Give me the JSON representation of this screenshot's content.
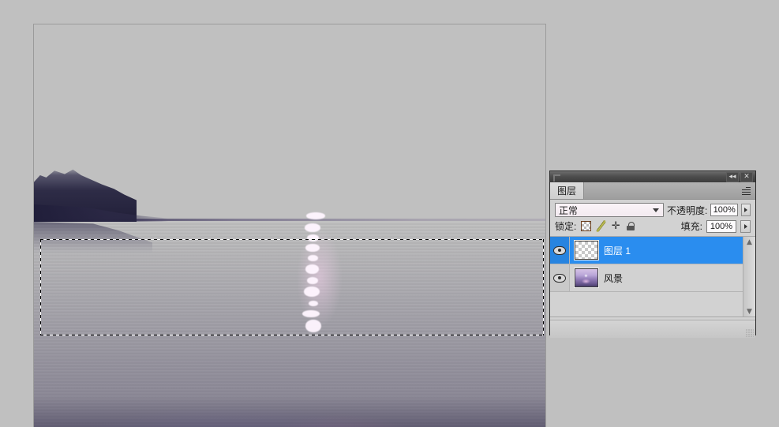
{
  "app": {
    "background_color": "#c0c0c0"
  },
  "canvas": {
    "name": "image-canvas",
    "selection": {
      "present": true,
      "style": "marching-ants-rectangle"
    },
    "image_description": "sunset-over-water-photo"
  },
  "layers_panel": {
    "titlebar": {
      "collapse_label": "◂◂",
      "close_label": "✕"
    },
    "tab_label": "图层",
    "menu_icon": "panel-menu-icon",
    "blend_mode": {
      "label": "",
      "value": "正常"
    },
    "opacity": {
      "label": "不透明度:",
      "value": "100%"
    },
    "fill": {
      "label": "填充:",
      "value": "100%"
    },
    "lock": {
      "label": "锁定:",
      "icons": [
        "lock-transparent-pixels-icon",
        "lock-image-pixels-icon",
        "lock-position-icon",
        "lock-all-icon"
      ],
      "move_glyph": "✛"
    },
    "layers": [
      {
        "name": "图层 1",
        "visible": true,
        "selected": true,
        "thumbnail": "transparent"
      },
      {
        "name": "风景",
        "visible": true,
        "selected": false,
        "thumbnail": "photo"
      }
    ],
    "scrollbar": {
      "up_glyph": "▲",
      "down_glyph": "▼"
    },
    "colors": {
      "selected_row": "#2a8def",
      "panel_bg": "#d2d2d2"
    }
  }
}
